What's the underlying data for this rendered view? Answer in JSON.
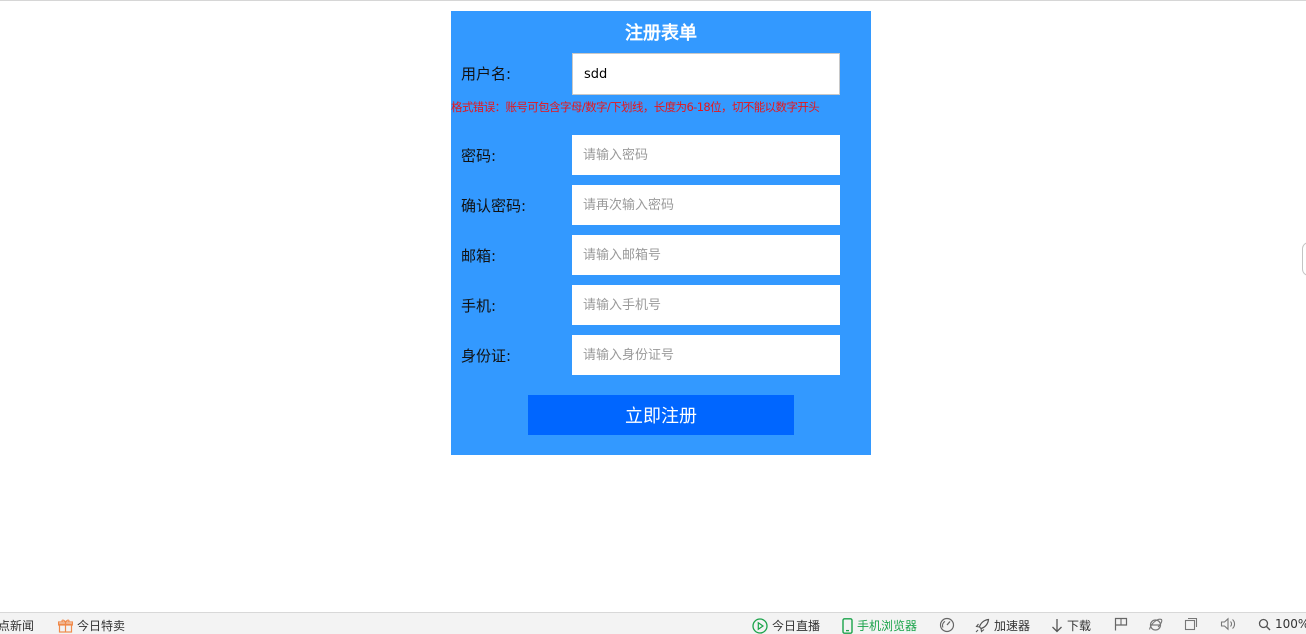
{
  "form": {
    "title": "注册表单",
    "username": {
      "label": "用户名:",
      "value": "sdd",
      "placeholder": ""
    },
    "username_error": "格式错误：账号可包含字母/数字/下划线，长度为6-18位，切不能以数字开头",
    "password": {
      "label": "密码:",
      "placeholder": "请输入密码"
    },
    "confirm_password": {
      "label": "确认密码:",
      "placeholder": "请再次输入密码"
    },
    "email": {
      "label": "邮箱:",
      "placeholder": "请输入邮箱号"
    },
    "phone": {
      "label": "手机:",
      "placeholder": "请输入手机号"
    },
    "id_card": {
      "label": "身份证:",
      "placeholder": "请输入身份证号"
    },
    "submit_label": "立即注册"
  },
  "status_bar": {
    "hot_news": "热点新闻",
    "today_deals": "今日特卖",
    "live": "今日直播",
    "mobile_browser": "手机浏览器",
    "accelerator": "加速器",
    "download": "下载",
    "zoom": "100%"
  },
  "colors": {
    "panel": "#3399ff",
    "button": "#0066ff",
    "error": "#e8161b",
    "green": "#1aa34a"
  }
}
